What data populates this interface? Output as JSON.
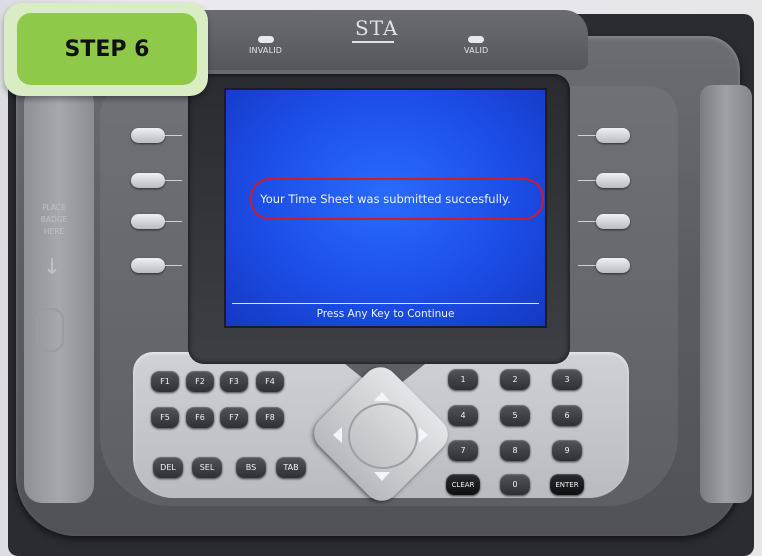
{
  "step_tag": "STEP 6",
  "device": {
    "logo": "STA",
    "led_invalid": "INVALID",
    "led_valid": "VALID",
    "badge_label": "PLACE BADGE HERE"
  },
  "screen": {
    "message": "Your Time Sheet was submitted succesfully.",
    "footer": "Press Any Key to Continue",
    "background_color": "#1c4ee8",
    "highlight_color": "#d11a2a"
  },
  "function_keys": [
    "F1",
    "F2",
    "F3",
    "F4",
    "F5",
    "F6",
    "F7",
    "F8"
  ],
  "edit_keys": [
    "DEL",
    "SEL",
    "BS",
    "TAB"
  ],
  "numeric_keys": [
    "1",
    "2",
    "3",
    "4",
    "5",
    "6",
    "7",
    "8",
    "9",
    "CLEAR",
    "0",
    "ENTER"
  ],
  "icons": {
    "badge_arrow": "down-arrow-icon",
    "dpad": "directional-pad-icon"
  }
}
